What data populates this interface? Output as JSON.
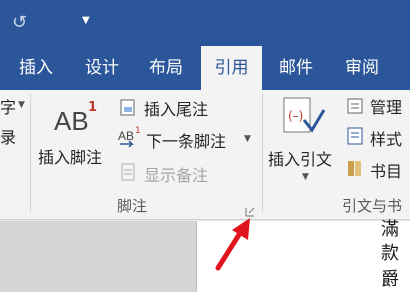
{
  "tabs": [
    "插入",
    "设计",
    "布局",
    "引用",
    "邮件",
    "审阅"
  ],
  "left_partial": [
    "字",
    "录"
  ],
  "footnotes": {
    "insert_footnote": "插入脚注",
    "icon_text": "AB",
    "icon_sup": "1",
    "insert_endnote": "插入尾注",
    "next_footnote": "下一条脚注",
    "show_notes": "显示备注",
    "group_label": "脚注"
  },
  "citations": {
    "insert_citation": "插入引文",
    "manage": "管理",
    "style": "样式",
    "bibliography": "书目",
    "group_label": "引文与书"
  },
  "document_text": [
    "滿",
    "款",
    "爵"
  ],
  "colors": {
    "ribbon_blue": "#2b579a",
    "arrow_red": "#e0141e"
  }
}
